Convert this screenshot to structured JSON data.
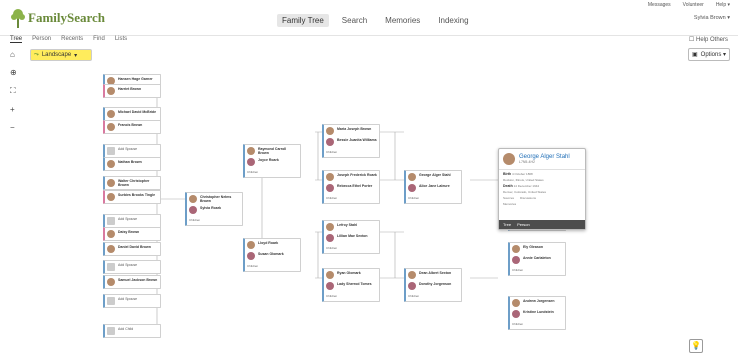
{
  "utility": {
    "messages": "Messages",
    "volunteer": "Volunteer",
    "help": "Help ▾"
  },
  "logo": "FamilySearch",
  "nav": [
    "Family Tree",
    "Search",
    "Memories",
    "Indexing"
  ],
  "user": "Sylvia Brown ▾",
  "subnav": [
    "Tree",
    "Person",
    "Recents",
    "Find",
    "Lists"
  ],
  "help_others": "Help Others",
  "view": {
    "label": "Landscape"
  },
  "options": "Options ▾",
  "col1": [
    {
      "name": "Hansen Hage Garner",
      "sex": "m"
    },
    {
      "name": "Harriet Brown",
      "sex": "f"
    },
    {
      "name": "Michael David McBride",
      "sex": "m"
    },
    {
      "name": "Francis Brown",
      "sex": "f"
    },
    {
      "name": "Add Spouse",
      "sex": "x"
    },
    {
      "name": "Nathan Brown",
      "sex": "m"
    },
    {
      "name": "Walter Christopher Brown",
      "sex": "m"
    },
    {
      "name": "Surbies Brooks Tingle",
      "sex": "f"
    },
    {
      "name": "Add Spouse",
      "sex": "x"
    },
    {
      "name": "Daisy Brown",
      "sex": "f"
    },
    {
      "name": "Daniel David Brown",
      "sex": "m"
    },
    {
      "name": "Add Spouse",
      "sex": "x"
    },
    {
      "name": "Samuel Jackson Brown",
      "sex": "m"
    },
    {
      "name": "Add Spouse",
      "sex": "x"
    },
    {
      "name": "Add Child",
      "sex": "x"
    }
  ],
  "col2": [
    {
      "name": "Raymond Carroll Brown",
      "spouse": "Joyce Roark"
    },
    {
      "name": "Christopher Nelms Brown",
      "spouse": "Sylvia Roark"
    },
    {
      "name": "Lloyd Roark",
      "spouse": "Susan Olomark"
    }
  ],
  "col3": [
    {
      "name": "Maria Joseph Brown",
      "spouse": "Bessie Juanita Williams"
    },
    {
      "name": "Joseph Frederick Roark",
      "spouse": "Rebecca Ethel Porter"
    },
    {
      "name": "Lefroy Stahl",
      "spouse": "Lillian Mae Sexton"
    },
    {
      "name": "Ryan Olomark",
      "spouse": "Lady Sherrod Tomes"
    }
  ],
  "col4": [
    {
      "name": "George Alger Stahl",
      "spouse": "Alice Jane Laleure"
    },
    {
      "name": "Dean Albert Sexton",
      "spouse": "Dorothy Jorgenson"
    }
  ],
  "col5": [
    {
      "name": "Dave Criddle"
    },
    {
      "name": "Ely Gleason",
      "spouse": "Annie Carlaleton"
    },
    {
      "name": "Andrew Jorgensen",
      "spouse": "Kristine Lundstein"
    }
  ],
  "popup": {
    "name": "George Alger Stahl",
    "id": "L7N5-4H2",
    "born_label": "Birth",
    "born": "4 October 1868",
    "born_place": "Rockton, Illinois, United States",
    "death_label": "Death",
    "death": "14 December 1944",
    "death_place": "Denver, Colorado, United States",
    "sources": "Sources",
    "memories": "Memories",
    "discussions": "Discussions",
    "foot_tree": "Tree",
    "foot_person": "Person"
  },
  "children_label": "Children"
}
